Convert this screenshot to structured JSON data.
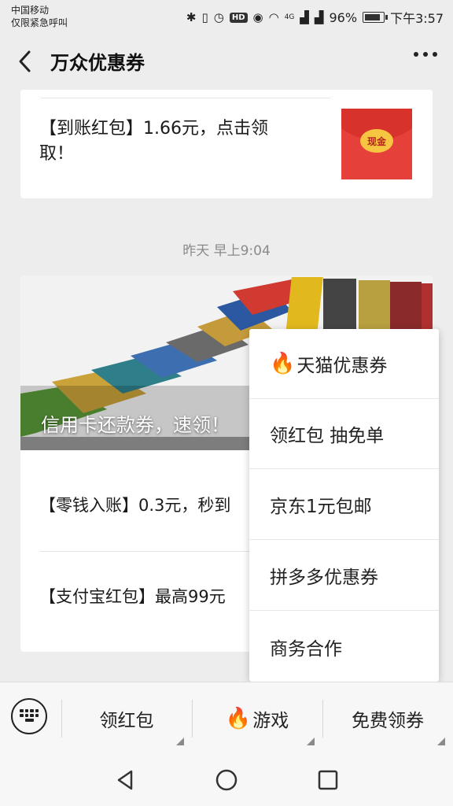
{
  "status_bar": {
    "carrier": "中国移动",
    "carrier_sub": "仅限紧急呼叫",
    "hd_badge": "HD",
    "network": "4G",
    "battery": "96%",
    "time": "下午3:57"
  },
  "nav": {
    "title": "万众优惠券"
  },
  "message1": {
    "text": "【到账红包】1.66元，点击领取！",
    "thumb_label": "现金"
  },
  "timestamp": "昨天 早上9:04",
  "article": {
    "banner_text": "信用卡还款券，速领！",
    "items": [
      {
        "text": "【零钱入账】0.3元，秒到"
      },
      {
        "text": "【支付宝红包】最高99元"
      }
    ]
  },
  "popup_menu": {
    "items": [
      {
        "label": "天猫优惠券",
        "icon": "flame-icon"
      },
      {
        "label": "领红包 抽免单"
      },
      {
        "label": "京东1元包邮"
      },
      {
        "label": "拼多多优惠券"
      },
      {
        "label": "商务合作"
      }
    ]
  },
  "bottom_menu": {
    "tabs": [
      {
        "label": "领红包"
      },
      {
        "label": "游戏",
        "icon": "flame-icon"
      },
      {
        "label": "免费领券"
      }
    ]
  },
  "colors": {
    "background": "#ededed",
    "red_packet": "#e6403a",
    "coin": "#f6c542"
  }
}
